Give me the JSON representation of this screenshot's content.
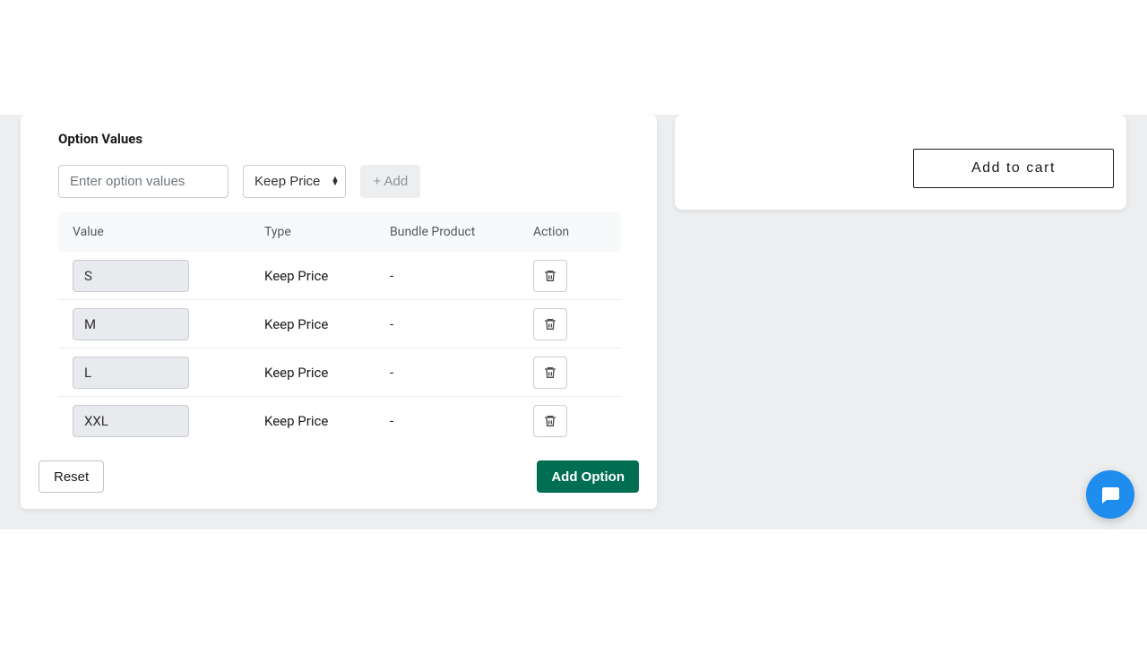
{
  "optionValues": {
    "title": "Option Values",
    "placeholder": "Enter option values",
    "keepPriceLabel": "Keep Price",
    "addLabel": "+ Add",
    "headers": {
      "value": "Value",
      "type": "Type",
      "bundle": "Bundle Product",
      "action": "Action"
    },
    "rows": [
      {
        "value": "S",
        "type": "Keep Price",
        "bundle": "-"
      },
      {
        "value": "M",
        "type": "Keep Price",
        "bundle": "-"
      },
      {
        "value": "L",
        "type": "Keep Price",
        "bundle": "-"
      },
      {
        "value": "XXL",
        "type": "Keep Price",
        "bundle": "-"
      }
    ],
    "resetLabel": "Reset",
    "addOptionLabel": "Add Option"
  },
  "cart": {
    "addToCartLabel": "Add to cart"
  }
}
